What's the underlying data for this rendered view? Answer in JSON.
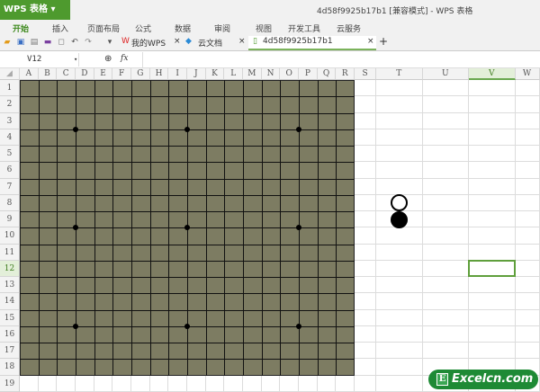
{
  "app": {
    "name": "WPS 表格",
    "title": "4d58f9925b17b1 [兼容模式] - WPS 表格"
  },
  "menu": [
    "开始",
    "插入",
    "页面布局",
    "公式",
    "数据",
    "审阅",
    "视图",
    "开发工具",
    "云服务"
  ],
  "tabs": [
    {
      "label": "我的WPS"
    },
    {
      "label": "云文档"
    },
    {
      "label": "4d58f9925b17b1"
    }
  ],
  "formula": {
    "name_box": "V12",
    "fx": "fx",
    "value": ""
  },
  "columns": [
    "A",
    "B",
    "C",
    "D",
    "E",
    "F",
    "G",
    "H",
    "I",
    "J",
    "K",
    "L",
    "M",
    "N",
    "O",
    "P",
    "Q",
    "R",
    "S",
    "T",
    "U",
    "V",
    "W"
  ],
  "rows": [
    "1",
    "2",
    "3",
    "4",
    "5",
    "6",
    "7",
    "8",
    "9",
    "10",
    "11",
    "12",
    "13",
    "14",
    "15",
    "16",
    "17",
    "18",
    "19"
  ],
  "selected_cell": "V12",
  "board": {
    "color": "#7d7c62",
    "star_points": [
      "D4",
      "J4",
      "P4",
      "D10",
      "J10",
      "P10",
      "D16",
      "J16",
      "P16"
    ],
    "stones": [
      {
        "cell": "T8",
        "color": "white"
      },
      {
        "cell": "T9",
        "color": "black"
      }
    ]
  },
  "watermark": {
    "letter": "E",
    "text": "Excelcn.com"
  }
}
